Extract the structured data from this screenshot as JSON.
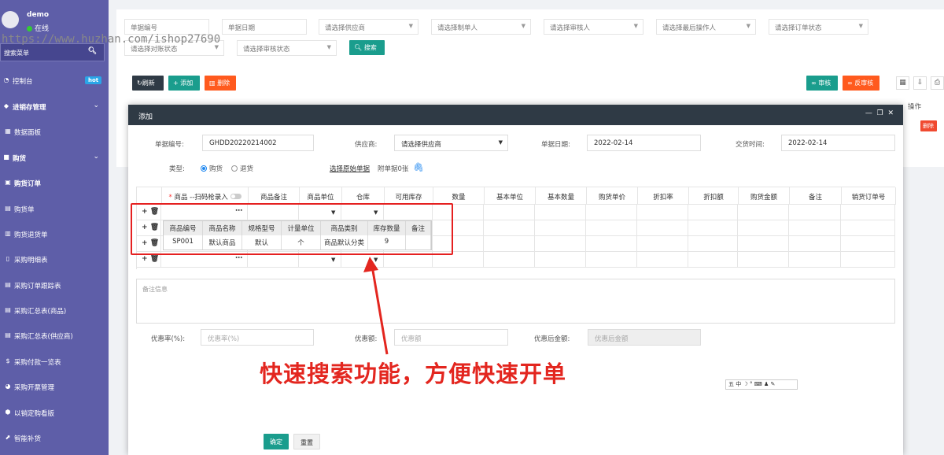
{
  "sidebar": {
    "username": "demo",
    "status": "在线",
    "search_placeholder": "搜索菜单",
    "items": [
      {
        "label": "控制台",
        "badge": "hot",
        "bold": false
      },
      {
        "label": "进销存管理",
        "bold": true,
        "expandable": true
      },
      {
        "label": "数据面板",
        "bold": false
      },
      {
        "label": "购货",
        "bold": true,
        "expandable": true
      },
      {
        "label": "购货订单",
        "bold": true
      },
      {
        "label": "购货单",
        "bold": false
      },
      {
        "label": "购货退货单",
        "bold": false
      },
      {
        "label": "采购明细表",
        "bold": false
      },
      {
        "label": "采购订单跟踪表",
        "bold": false
      },
      {
        "label": "采购汇总表(商品)",
        "bold": false
      },
      {
        "label": "采购汇总表(供应商)",
        "bold": false
      },
      {
        "label": "采购付款一览表",
        "bold": false
      },
      {
        "label": "采购开票管理",
        "bold": false
      },
      {
        "label": "以销定购看版",
        "bold": false
      },
      {
        "label": "智能补货",
        "bold": false
      }
    ]
  },
  "watermark": "https://www.huzhan.com/ishop27690",
  "filters": {
    "bill_no": "单据编号",
    "bill_date": "单据日期",
    "supplier": "请选择供应商",
    "creator": "请选择制单人",
    "reviewer": "请选择审核人",
    "last_operator": "请选择最后操作人",
    "order_status": "请选择订单状态",
    "reconcile_status": "请选择对账状态",
    "review_status": "请选择审核状态",
    "search_label": "搜索"
  },
  "toolbar": {
    "refresh": "刷新",
    "add": "添加",
    "delete": "删除",
    "approve": "审核",
    "unapprove": "反审核",
    "operation_header": "操作",
    "row_action": "删除"
  },
  "modal": {
    "title": "添加",
    "bill_no_label": "单据编号:",
    "bill_no_value": "GHDD20220214002",
    "supplier_label": "供应商:",
    "supplier_placeholder": "请选择供应商",
    "bill_date_label": "单据日期:",
    "bill_date_value": "2022-02-14",
    "trade_time_label": "交货时间:",
    "trade_time_value": "2022-02-14",
    "type_label": "类型:",
    "type_purchase": "购货",
    "type_return": "退货",
    "select_source": "选择原始单据",
    "attachment": "附单据0张",
    "columns": [
      "商品 --扫码枪录入",
      "商品备注",
      "商品单位",
      "仓库",
      "可用库存",
      "数量",
      "基本单位",
      "基本数量",
      "购货单价",
      "折扣率",
      "折扣额",
      "购货金额",
      "备注",
      "销货订单号"
    ],
    "popup": {
      "headers": [
        "商品编号",
        "商品名称",
        "规格型号",
        "计量单位",
        "商品类别",
        "库存数量",
        "备注"
      ],
      "rows": [
        [
          "SP001",
          "默认商品",
          "默认",
          "个",
          "商品默认分类",
          "9",
          ""
        ]
      ]
    },
    "remark_placeholder": "备注信息",
    "discount_rate_label": "优惠率(%):",
    "discount_rate_placeholder": "优惠率(%)",
    "discount_amount_label": "优惠额:",
    "discount_amount_placeholder": "优惠额",
    "after_discount_label": "优惠后金额:",
    "after_discount_placeholder": "优惠后金额",
    "confirm": "确定",
    "reset": "重置"
  },
  "annotation": "快速搜索功能，方便快速开单",
  "ime_bar": "五 中 ☽ ° ⌨ ♟ ✎",
  "colors": {
    "sidebar": "#5e5ea8",
    "teal": "#1a9d8d",
    "orange": "#ff5a1e",
    "dark": "#2f3a45",
    "annotation": "#e3261f"
  }
}
